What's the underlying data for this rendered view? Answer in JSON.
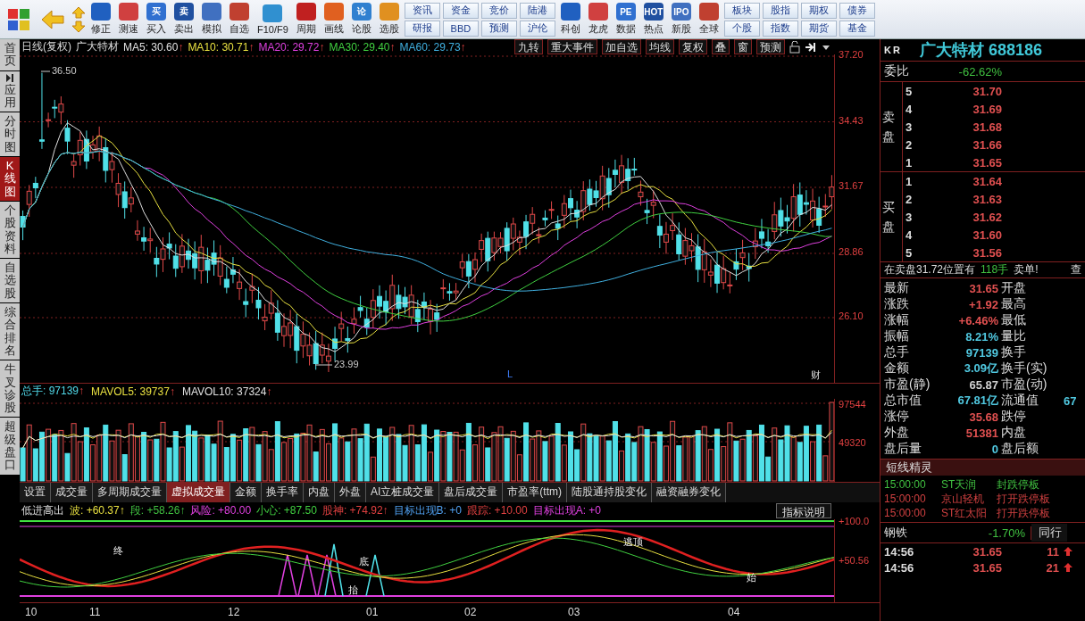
{
  "toolbar": [
    {
      "kind": "grid"
    },
    {
      "kind": "back"
    },
    {
      "kind": "updown"
    },
    {
      "kind": "icon",
      "label": "修正"
    },
    {
      "kind": "icon",
      "label": "测速"
    },
    {
      "kind": "icon",
      "label": "买入",
      "glyph": "买"
    },
    {
      "kind": "icon",
      "label": "卖出",
      "glyph": "卖"
    },
    {
      "kind": "icon",
      "label": "模拟"
    },
    {
      "kind": "icon",
      "label": "自选"
    },
    {
      "kind": "icon",
      "label": "F10/F9"
    },
    {
      "kind": "icon",
      "label": "周期"
    },
    {
      "kind": "icon",
      "label": "画线"
    },
    {
      "kind": "icon",
      "label": "论股",
      "glyph": "论"
    },
    {
      "kind": "icon",
      "label": "选股"
    },
    {
      "kind": "pair",
      "top": "资讯",
      "bottom": "研报"
    },
    {
      "kind": "pair",
      "top": "资金",
      "bottom": "BBD"
    },
    {
      "kind": "pair",
      "top": "竞价",
      "bottom": "预测"
    },
    {
      "kind": "pair",
      "top": "陆港",
      "bottom": "沪伦"
    },
    {
      "kind": "icon",
      "label": "科创"
    },
    {
      "kind": "icon",
      "label": "龙虎"
    },
    {
      "kind": "icon",
      "label": "数据",
      "glyph": "PE"
    },
    {
      "kind": "icon",
      "label": "热点",
      "glyph": "HOT"
    },
    {
      "kind": "icon",
      "label": "新股",
      "glyph": "IPO"
    },
    {
      "kind": "icon",
      "label": "全球"
    },
    {
      "kind": "pair",
      "top": "板块",
      "bottom": "个股"
    },
    {
      "kind": "pair",
      "top": "股指",
      "bottom": "指数"
    },
    {
      "kind": "pair",
      "top": "期权",
      "bottom": "期货"
    },
    {
      "kind": "pair",
      "top": "债券",
      "bottom": "基金"
    }
  ],
  "sidebar": [
    {
      "label": "首页",
      "selected": false
    },
    {
      "label": "应用",
      "selected": false,
      "kind": "app"
    },
    {
      "label": "分时图",
      "selected": false
    },
    {
      "label": "K线图",
      "selected": true
    },
    {
      "label": "个股资料",
      "selected": false
    },
    {
      "label": "自选股",
      "selected": false
    },
    {
      "label": "综合排名",
      "selected": false
    },
    {
      "label": "牛叉诊股",
      "selected": false
    },
    {
      "label": "超级盘口",
      "selected": false
    }
  ],
  "chart_header": {
    "period": "日线(复权)",
    "name": "广大特材",
    "indicators": [
      {
        "label": "MA5: 30.60",
        "color": "#e0e0e0"
      },
      {
        "label": "MA10: 30.71",
        "color": "#e8e040"
      },
      {
        "label": "MA20: 29.72",
        "color": "#e040e0"
      },
      {
        "label": "MA30: 29.40",
        "color": "#40d040"
      },
      {
        "label": "MA60: 29.73",
        "color": "#40b0e0"
      }
    ],
    "arrow": "↑",
    "buttons": [
      "九转",
      "重大事件",
      "加自选",
      "均线",
      "复权",
      "叠",
      "窗",
      "预测"
    ]
  },
  "price_axis": [
    "37.20",
    "34.43",
    "31.67",
    "28.86",
    "26.10"
  ],
  "price_marks": [
    "36.50",
    "23.99"
  ],
  "chart_flags": [
    "L",
    "财"
  ],
  "volume_header": [
    {
      "label": "总手: 97139",
      "color": "#50d8e8"
    },
    {
      "label": "MAVOL5: 39737",
      "color": "#e8e040"
    },
    {
      "label": "MAVOL10: 37324",
      "color": "#e0e0e0"
    }
  ],
  "volume_axis": [
    "97544",
    "49320"
  ],
  "tabs": [
    {
      "label": "设置",
      "selected": false
    },
    {
      "label": "成交量",
      "selected": false
    },
    {
      "label": "多周期成交量",
      "selected": false
    },
    {
      "label": "虚拟成交量",
      "selected": true
    },
    {
      "label": "金额",
      "selected": false
    },
    {
      "label": "换手率",
      "selected": false
    },
    {
      "label": "内盘",
      "selected": false
    },
    {
      "label": "外盘",
      "selected": false
    },
    {
      "label": "AI立桩成交量",
      "selected": false
    },
    {
      "label": "盘后成交量",
      "selected": false
    },
    {
      "label": "市盈率(ttm)",
      "selected": false
    },
    {
      "label": "陆股通持股变化",
      "selected": false
    },
    {
      "label": "融资融券变化",
      "selected": false
    }
  ],
  "indicator_header": {
    "name": "低进高出",
    "items": [
      {
        "label": "波: +60.37↑",
        "color": "#e8e040"
      },
      {
        "label": "段: +58.26↑",
        "color": "#40c040"
      },
      {
        "label": "风险: +80.00",
        "color": "#e040e0"
      },
      {
        "label": "小心: +87.50",
        "color": "#40d040"
      },
      {
        "label": "股神: +74.92↑",
        "color": "#e04040"
      },
      {
        "label": "目标出现B: +0",
        "color": "#50a0f0"
      },
      {
        "label": "跟踪: +10.00",
        "color": "#e04040"
      },
      {
        "label": "目标出现A: +0",
        "color": "#e040e0"
      }
    ],
    "help_button": "指标说明"
  },
  "indicator_axis": [
    "+100.0",
    "+50.56"
  ],
  "indicator_marks": [
    "终",
    "逃顶",
    "底",
    "抬",
    "始"
  ],
  "dates": [
    "10",
    "11",
    "12",
    "01",
    "02",
    "03",
    "04"
  ],
  "quote": {
    "market": "KR",
    "title": "广大特材 688186",
    "ratio_label": "委比",
    "ratio": "-62.62%",
    "sell_label": "卖盘",
    "buy_label": "买盘",
    "sell": [
      {
        "level": "5",
        "price": "31.70"
      },
      {
        "level": "4",
        "price": "31.69"
      },
      {
        "level": "3",
        "price": "31.68"
      },
      {
        "level": "2",
        "price": "31.66"
      },
      {
        "level": "1",
        "price": "31.65"
      }
    ],
    "buy": [
      {
        "level": "1",
        "price": "31.64"
      },
      {
        "level": "2",
        "price": "31.63"
      },
      {
        "level": "3",
        "price": "31.62"
      },
      {
        "level": "4",
        "price": "31.60"
      },
      {
        "level": "5",
        "price": "31.56"
      }
    ],
    "notice": {
      "text": "在卖盘31.72位置有",
      "volume": "118手",
      "suffix": "卖单!",
      "link": "查"
    },
    "stats": [
      {
        "label": "最新",
        "value": "31.65",
        "color": "#e05050",
        "label2": "开盘"
      },
      {
        "label": "涨跌",
        "value": "+1.92",
        "color": "#e05050",
        "label2": "最高"
      },
      {
        "label": "涨幅",
        "value": "+6.46%",
        "color": "#e05050",
        "label2": "最低"
      },
      {
        "label": "振幅",
        "value": "8.21%",
        "color": "#50c8e0",
        "label2": "量比"
      },
      {
        "label": "总手",
        "value": "97139",
        "color": "#50c8e0",
        "label2": "换手"
      },
      {
        "label": "金额",
        "value": "3.09亿",
        "color": "#50c8e0",
        "label2": "换手(实)"
      },
      {
        "label": "市盈(静)",
        "value": "65.87",
        "color": "#d0d0d0",
        "label2": "市盈(动)"
      },
      {
        "label": "总市值",
        "value": "67.81亿",
        "color": "#50c8e0",
        "label2": "流通值",
        "value2": "67"
      },
      {
        "label": "涨停",
        "value": "35.68",
        "color": "#e05050",
        "label2": "跌停"
      },
      {
        "label": "外盘",
        "value": "51381",
        "color": "#e05050",
        "label2": "内盘"
      },
      {
        "label": "盘后量",
        "value": "0",
        "color": "#50c8e0",
        "label2": "盘后额"
      }
    ],
    "alerts_title": "短线精灵",
    "alerts": [
      {
        "time": "15:00:00",
        "name": "ST天润",
        "event": "封跌停板",
        "color": "#40c040"
      },
      {
        "time": "15:00:00",
        "name": "京山轻机",
        "event": "打开跌停板",
        "color": "#d04040"
      },
      {
        "time": "15:00:00",
        "name": "ST红太阳",
        "event": "打开跌停板",
        "color": "#d04040"
      }
    ],
    "industry": {
      "name": "钢铁",
      "change": "-1.70%",
      "peer_tab": "同行"
    },
    "ticks": [
      {
        "time": "14:56",
        "price": "31.65",
        "volume": "11"
      },
      {
        "time": "14:56",
        "price": "31.65",
        "volume": "21"
      }
    ]
  }
}
